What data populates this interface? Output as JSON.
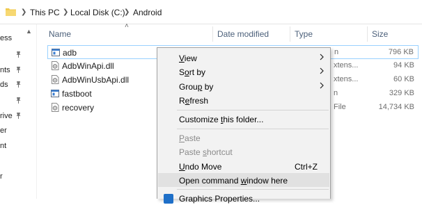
{
  "breadcrumb": {
    "items": [
      "This PC",
      "Local Disk (C:)",
      "Android"
    ]
  },
  "nav_pane": {
    "items": [
      "ess",
      "nts",
      "ds",
      "rive",
      "er",
      "nt",
      "r"
    ]
  },
  "columns": {
    "name": "Name",
    "date_modified": "Date modified",
    "type": "Type",
    "size": "Size"
  },
  "files": [
    {
      "name": "adb",
      "type": "n",
      "size": "796 KB",
      "icon": "application-icon",
      "selected": true
    },
    {
      "name": "AdbWinApi.dll",
      "type": "xtens...",
      "size": "94 KB",
      "icon": "dll-gear-icon"
    },
    {
      "name": "AdbWinUsbApi.dll",
      "type": "xtens...",
      "size": "60 KB",
      "icon": "dll-gear-icon"
    },
    {
      "name": "fastboot",
      "type": "n",
      "size": "329 KB",
      "icon": "application-icon"
    },
    {
      "name": "recovery",
      "type": "File",
      "size": "14,734 KB",
      "icon": "file-gear-icon"
    }
  ],
  "context_menu": {
    "view": {
      "pre": "",
      "key": "V",
      "post": "iew"
    },
    "sort_by": {
      "pre": "S",
      "key": "o",
      "post": "rt by"
    },
    "group_by": {
      "pre": "Grou",
      "key": "p",
      "post": " by"
    },
    "refresh": {
      "pre": "R",
      "key": "e",
      "post": "fresh"
    },
    "customize": {
      "pre": "Customize ",
      "key": "t",
      "post": "his folder..."
    },
    "paste": {
      "pre": "",
      "key": "P",
      "post": "aste"
    },
    "paste_shortcut": {
      "pre": "Paste ",
      "key": "s",
      "post": "hortcut"
    },
    "undo_move": {
      "pre": "",
      "key": "U",
      "post": "ndo Move"
    },
    "undo_shortcut": "Ctrl+Z",
    "open_cmd": {
      "pre": "Open command ",
      "key": "w",
      "post": "indow here"
    },
    "graphics": "Graphics Properties..."
  },
  "colors": {
    "selection_border": "#99d1ff",
    "menu_background": "#f2f2f2",
    "menu_highlight": "#e1e1e1",
    "column_header_text": "#4c607a",
    "folder_yellow": "#f0c94b"
  }
}
